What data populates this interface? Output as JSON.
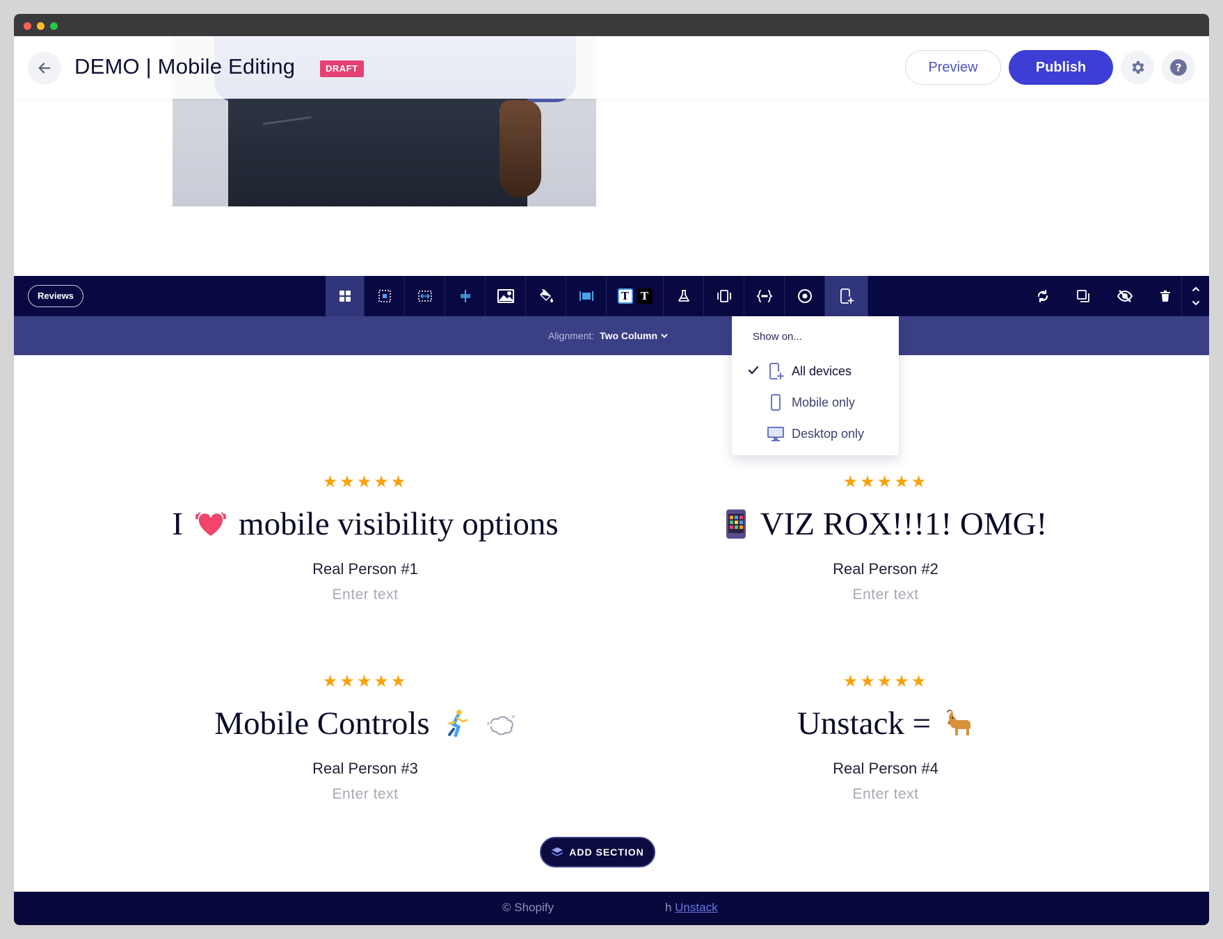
{
  "header": {
    "title": "DEMO | Mobile Editing",
    "status_badge": "DRAFT",
    "preview_label": "Preview",
    "publish_label": "Publish"
  },
  "toolbar": {
    "section_name": "Reviews",
    "tools": [
      "layout-icon",
      "spacing-icon",
      "width-icon",
      "align-center-icon",
      "image-icon",
      "paint-bucket-icon",
      "full-width-icon",
      "text-style-icon",
      "lab-flask-icon",
      "carousel-icon",
      "code-icon",
      "circle-dot-icon",
      "device-visibility-icon"
    ],
    "text_style_glyph": "T",
    "right_tools": [
      "refresh-icon",
      "duplicate-icon",
      "hide-icon",
      "trash-icon",
      "move-updown-icon"
    ]
  },
  "subbar": {
    "alignment_label": "Alignment:",
    "alignment_value": "Two Column"
  },
  "visibility_menu": {
    "heading": "Show on...",
    "items": [
      {
        "label": "All devices",
        "icon": "mobile-plus-icon",
        "selected": true
      },
      {
        "label": "Mobile only",
        "icon": "mobile-icon",
        "selected": false
      },
      {
        "label": "Desktop only",
        "icon": "desktop-icon",
        "selected": false
      }
    ]
  },
  "reviews": [
    {
      "rating": 5,
      "stars": "★★★★★",
      "headline_before": "I",
      "emoji": "beating-heart",
      "headline_after": "mobile visibility options",
      "person": "Real Person #1",
      "placeholder": "Enter text"
    },
    {
      "rating": 5,
      "stars": "★★★★★",
      "headline_before": "",
      "emoji": "mobile-phone",
      "headline_after": "VIZ ROX!!!1! OMG!",
      "person": "Real Person #2",
      "placeholder": "Enter text"
    },
    {
      "rating": 5,
      "stars": "★★★★★",
      "headline_before": "Mobile Controls",
      "emoji": "runner-dash",
      "headline_after": "",
      "person": "Real Person #3",
      "placeholder": "Enter text"
    },
    {
      "rating": 5,
      "stars": "★★★★★",
      "headline_before": "Unstack =",
      "emoji": "goat",
      "headline_after": "",
      "person": "Real Person #4",
      "placeholder": "Enter text"
    }
  ],
  "footer": {
    "text_visible": "© Shopify",
    "text_tail": "h",
    "link_label": "Unstack",
    "add_section_label": "ADD SECTION"
  },
  "colors": {
    "accent": "#3c3ed6",
    "toolbar_bg": "#080942",
    "subbar_bg": "#3b3f86",
    "draft_badge": "#e44174",
    "star": "#f7a20c"
  }
}
